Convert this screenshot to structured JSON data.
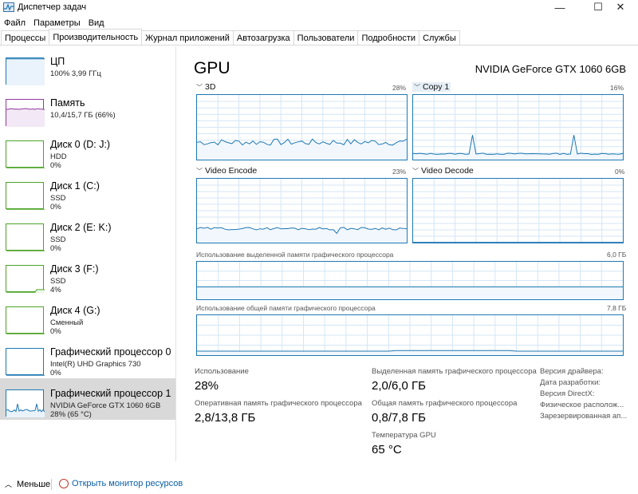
{
  "window": {
    "title": "Диспетчер задач",
    "minimize": "—",
    "maximize": "☐",
    "close": "✕"
  },
  "menu": [
    "Файл",
    "Параметры",
    "Вид"
  ],
  "tabs": [
    "Процессы",
    "Производительность",
    "Журнал приложений",
    "Автозагрузка",
    "Пользователи",
    "Подробности",
    "Службы"
  ],
  "sidebar": [
    {
      "name": "ЦП",
      "lines": [
        "100% 3,99 ГГц"
      ],
      "color": "#1f78b4"
    },
    {
      "name": "Память",
      "lines": [
        "10,4/15,7 ГБ (66%)"
      ],
      "color": "#8e3a9d"
    },
    {
      "name": "Диск 0 (D: J:)",
      "lines": [
        "HDD",
        "0%"
      ],
      "color": "#4da427"
    },
    {
      "name": "Диск 1 (C:)",
      "lines": [
        "SSD",
        "0%"
      ],
      "color": "#4da427"
    },
    {
      "name": "Диск 2 (E: K:)",
      "lines": [
        "SSD",
        "0%"
      ],
      "color": "#4da427"
    },
    {
      "name": "Диск 3 (F:)",
      "lines": [
        "SSD",
        "4%"
      ],
      "color": "#4da427"
    },
    {
      "name": "Диск 4 (G:)",
      "lines": [
        "Сменный",
        "0%"
      ],
      "color": "#4da427"
    },
    {
      "name": "Графический процессор 0",
      "lines": [
        "Intel(R) UHD Graphics 730",
        "0%"
      ],
      "color": "#1f78b4"
    },
    {
      "name": "Графический процессор 1",
      "lines": [
        "NVIDIA GeForce GTX 1060 6GB",
        "28% (65 °C)"
      ],
      "color": "#1f78b4"
    }
  ],
  "main": {
    "title": "GPU",
    "model": "NVIDIA GeForce GTX 1060 6GB",
    "engines": [
      {
        "label": "3D",
        "percent": "28%"
      },
      {
        "label": "Copy 1",
        "percent": "16%"
      },
      {
        "label": "Video Encode",
        "percent": "23%"
      },
      {
        "label": "Video Decode",
        "percent": "0%"
      }
    ],
    "dedicated_label": "Использование выделенной памяти графического процессора",
    "dedicated_max": "6,0 ГБ",
    "shared_label": "Использование общей памяти графического процессора",
    "shared_max": "7,8 ГБ",
    "stats": {
      "usage_label": "Использование",
      "usage_value": "28%",
      "ram_label": "Оперативная память графического процессора",
      "ram_value": "2,8/13,8 ГБ",
      "dedicated_label": "Выделенная память графического процессора",
      "dedicated_value": "2,0/6,0 ГБ",
      "shared_label": "Общая память графического процессора",
      "shared_value": "0,8/7,8 ГБ",
      "temp_label": "Температура GPU",
      "temp_value": "65 °C"
    },
    "info": [
      "Версия драйвера:",
      "Дата разработки:",
      "Версия DirectX:",
      "Физическое располож...",
      "Зарезервированная ап..."
    ]
  },
  "footer": {
    "less": "Меньше",
    "monitor": "Открыть монитор ресурсов"
  },
  "colors": {
    "gpu": "#1f78b4",
    "grid": "#d4e6f5",
    "fill": "#f1f7fc"
  }
}
